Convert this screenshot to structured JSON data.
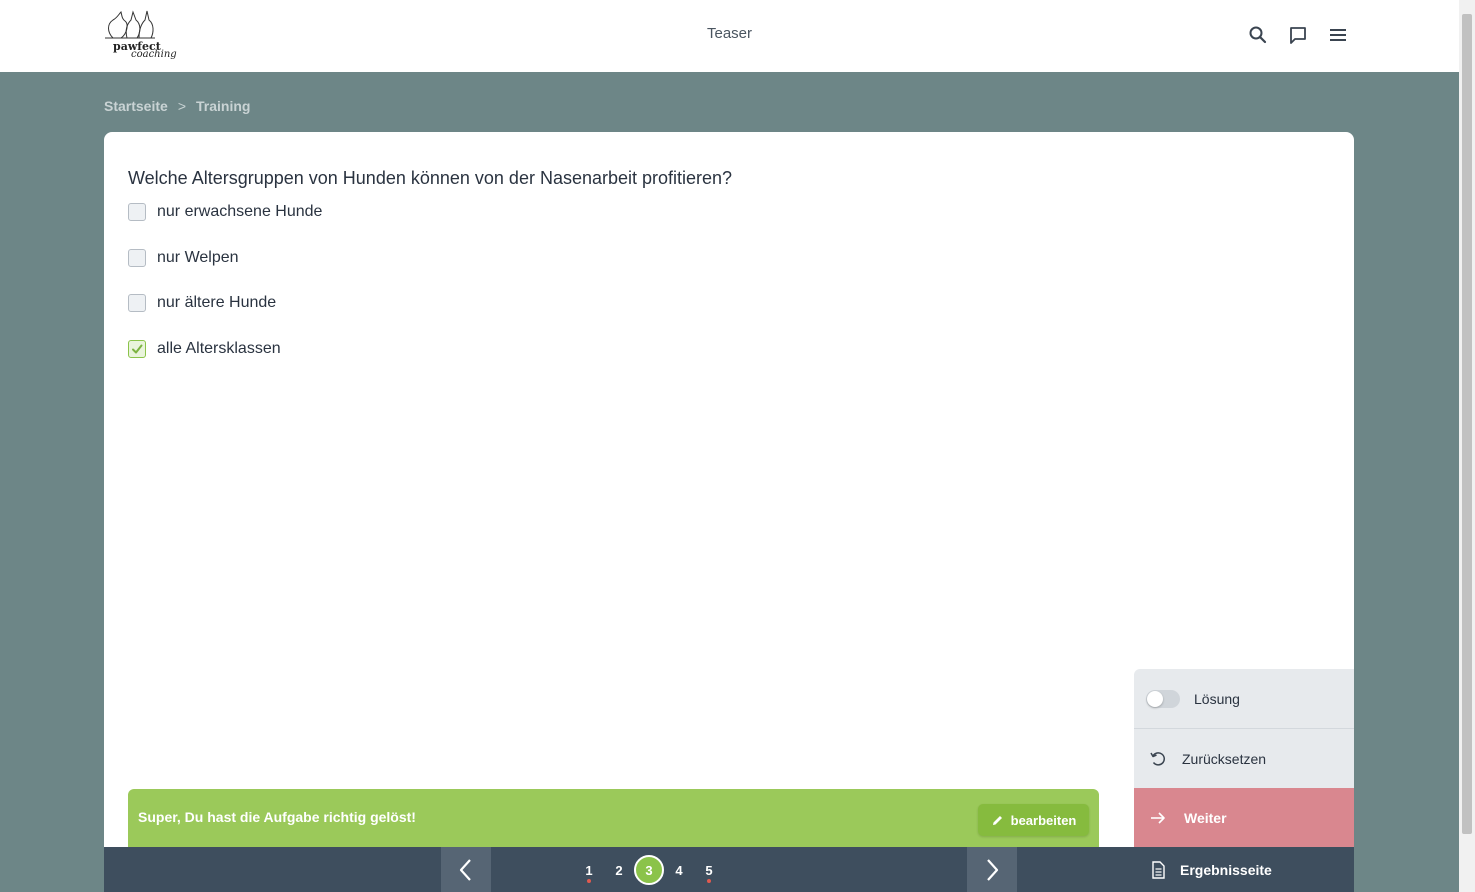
{
  "header": {
    "logo_line1": "pawfect",
    "logo_line2": "coaching",
    "title": "Teaser",
    "icons": [
      "search-icon",
      "chat-icon",
      "menu-icon"
    ]
  },
  "breadcrumb": {
    "items": [
      "Startseite",
      "Training"
    ],
    "separator": ">"
  },
  "quiz": {
    "question": "Welche Altersgruppen von Hunden können von der Nasenarbeit profitieren?",
    "options": [
      {
        "label": "nur erwachsene Hunde",
        "checked": false
      },
      {
        "label": "nur Welpen",
        "checked": false
      },
      {
        "label": "nur ältere Hunde",
        "checked": false
      },
      {
        "label": "alle Altersklassen",
        "checked": true
      }
    ]
  },
  "feedback": {
    "message": "Super, Du hast die Aufgabe richtig gelöst!",
    "edit_label": "bearbeiten"
  },
  "side_panel": {
    "solution_label": "Lösung",
    "solution_toggle_on": false,
    "reset_label": "Zurücksetzen",
    "next_label": "Weiter",
    "results_label": "Ergebnisseite"
  },
  "pagination": {
    "pages": [
      "1",
      "2",
      "3",
      "4",
      "5"
    ],
    "active": "3",
    "marked_pages": [
      "1",
      "5"
    ]
  },
  "colors": {
    "background": "#6d8687",
    "accent_green": "#8bc34a",
    "feedback_green": "#9bc95a",
    "next_pink": "#d9878f",
    "dark_bar": "#3e4e5e",
    "marker_red": "#e05a4f"
  }
}
